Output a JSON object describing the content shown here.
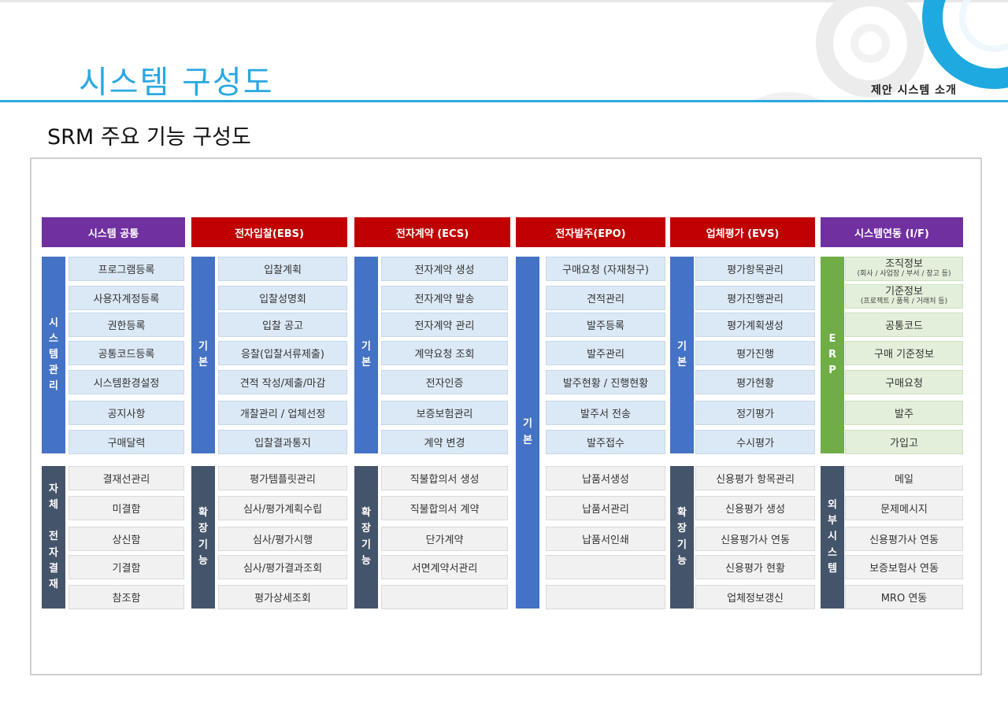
{
  "header": {
    "title": "시스템 구성도",
    "tag": "제안 시스템 소개"
  },
  "subtitle": "SRM 주요 기능 구성도",
  "columns": [
    {
      "title": "시스템 공통",
      "basic_label": "시\n스\n템\n관\n리",
      "basic_items": [
        "프로그램등록",
        "사용자계정등록",
        "권한등록",
        "공통코드등록",
        "시스템환경설정",
        "공지사항",
        "구매달력"
      ],
      "ext_label": "자\n체\n\n전\n자\n결\n재",
      "ext_items": [
        "결재선관리",
        "미결함",
        "상신함",
        "기결함",
        "참조함"
      ]
    },
    {
      "title": "전자입찰(EBS)",
      "basic_label": "기\n본",
      "basic_items": [
        "입찰계획",
        "입찰성명회",
        "입찰 공고",
        "응찰(입찰서류제출)",
        "견적 작성/제출/마감",
        "개찰관리 / 업체선정",
        "입찰결과통지"
      ],
      "ext_label": "확\n장\n기\n능",
      "ext_items": [
        "평가템플릿관리",
        "심사/평가계획수립",
        "심사/평가시행",
        "심사/평가결과조회",
        "평가상세조회"
      ]
    },
    {
      "title": "전자계약 (ECS)",
      "basic_label": "기\n본",
      "basic_items": [
        "전자계약 생성",
        "전자계약 발송",
        "전자계약 관리",
        "계약요청 조회",
        "전자인증",
        "보증보험관리",
        "계약 변경"
      ],
      "ext_label": "확\n장\n기\n능",
      "ext_items": [
        "직불합의서 생성",
        "직불합의서 계약",
        "단가계약",
        "서면계약서관리",
        ""
      ]
    },
    {
      "title": "전자발주(EPO)",
      "basic_label": "기\n본",
      "basic_items": [
        "구매요청 (자재청구)",
        "견적관리",
        "발주등록",
        "발주관리",
        "발주현황 / 진행현황",
        "발주서 전송",
        "발주접수"
      ],
      "ext_items": [
        "납품서생성",
        "납품서관리",
        "납품서인쇄",
        "",
        ""
      ]
    },
    {
      "title": "업체평가 (EVS)",
      "basic_label": "기\n본",
      "basic_items": [
        "평가항목관리",
        "평가진행관리",
        "평가계획생성",
        "평가진행",
        "평가현황",
        "정기평가",
        "수시평가"
      ],
      "ext_label": "확\n장\n기\n능",
      "ext_items": [
        "신용평가 항목관리",
        "신용평가 생성",
        "신용평가사 연동",
        "신용평가 현황",
        "업체정보갱신"
      ]
    },
    {
      "title": "시스템연동 (I/F)",
      "basic_label": "E\nR\nP",
      "basic_items": [
        {
          "main": "조직정보",
          "sub": "(회사 / 사업장 / 부서 / 창고 등)"
        },
        {
          "main": "기준정보",
          "sub": "(프로젝트 / 품목 / 거래처 등)"
        },
        {
          "main": "공통코드"
        },
        {
          "main": "구매 기준정보"
        },
        {
          "main": "구매요청"
        },
        {
          "main": "발주"
        },
        {
          "main": "가입고"
        }
      ],
      "ext_label": "외\n부\n시\n스\n템",
      "ext_items": [
        "메일",
        "문제메시지",
        "신용평가사 연동",
        "보증보험사 연동",
        "MRO  연동"
      ]
    }
  ],
  "colors": {
    "accent": "#29a8e0",
    "header_purple": "#7030a0",
    "header_red": "#c00000",
    "bar_blue": "#4472c4",
    "bar_slate": "#44546a",
    "bar_green": "#70ad47",
    "cell_basic": "#dbe8f5",
    "cell_ext": "#f1f1f1",
    "cell_erp": "#e3efda"
  }
}
